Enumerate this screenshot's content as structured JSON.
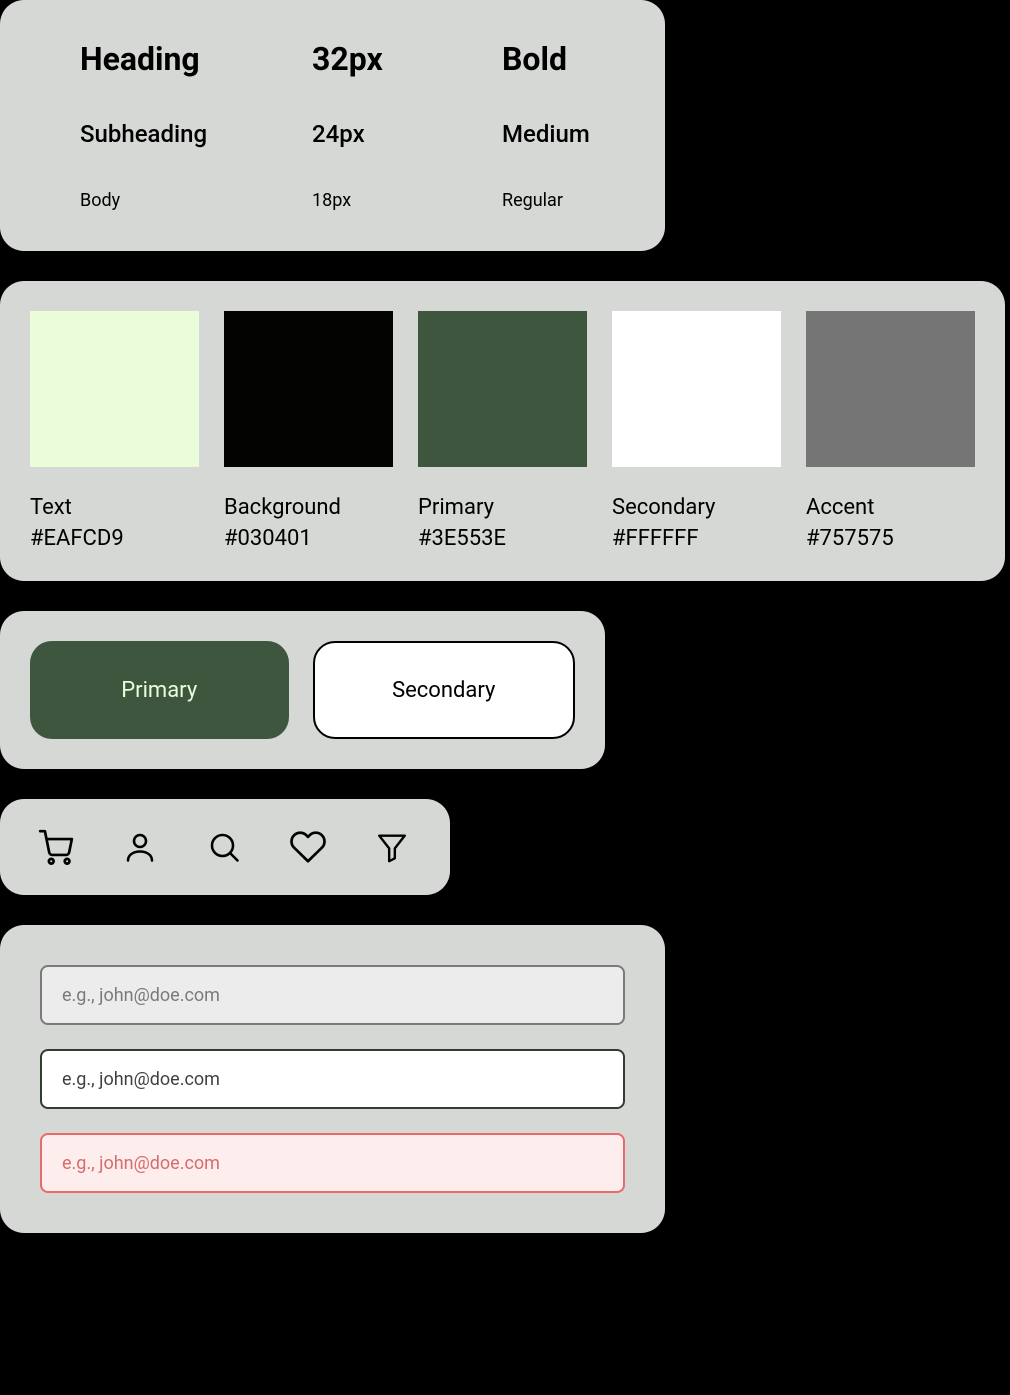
{
  "typography": {
    "rows": [
      {
        "label": "Heading",
        "size": "32px",
        "weight": "Bold"
      },
      {
        "label": "Subheading",
        "size": "24px",
        "weight": "Medium"
      },
      {
        "label": "Body",
        "size": "18px",
        "weight": "Regular"
      }
    ]
  },
  "palette": [
    {
      "label": "Text",
      "hex": "#EAFCD9"
    },
    {
      "label": "Background",
      "hex": "#030401"
    },
    {
      "label": "Primary",
      "hex": "#3E553E"
    },
    {
      "label": "Secondary",
      "hex": "#FFFFFF"
    },
    {
      "label": "Accent",
      "hex": "#757575"
    }
  ],
  "buttons": {
    "primary_label": "Primary",
    "secondary_label": "Secondary"
  },
  "icons": [
    {
      "name": "cart"
    },
    {
      "name": "user"
    },
    {
      "name": "search"
    },
    {
      "name": "heart"
    },
    {
      "name": "filter"
    }
  ],
  "inputs": {
    "default_placeholder": "e.g., john@doe.com",
    "active_placeholder": "e.g., john@doe.com",
    "error_placeholder": "e.g., john@doe.com"
  }
}
